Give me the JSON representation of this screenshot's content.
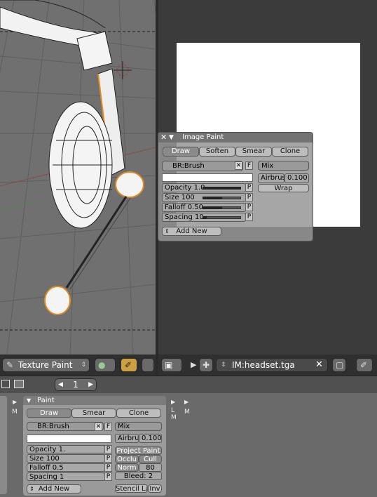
{
  "viewport3d": {
    "mode_label": "Texture Paint"
  },
  "image_editor": {
    "image_name": "IM:headset.tga"
  },
  "image_paint_panel": {
    "title": "Image Paint",
    "tabs": [
      "Draw",
      "Soften",
      "Smear",
      "Clone"
    ],
    "active_tab": "Draw",
    "brush_name": "BR:Brush",
    "brush_x": "✕",
    "brush_f": "F",
    "blend_mode": "Mix",
    "airbrush_label": "Airbrus",
    "airbrush_value": "0.100",
    "wrap_label": "Wrap",
    "opacity_label": "Opacity 1.0",
    "size_label": "Size 100",
    "falloff_label": "Falloff 0.50",
    "spacing_label": "Spacing 10.",
    "p_label": "P",
    "add_new": "Add New",
    "opacity_level": 1.0,
    "size_level": 0.5,
    "falloff_level": 0.5,
    "spacing_level": 0.1
  },
  "bottom": {
    "frame_value": "1",
    "panel_title": "Paint",
    "tabs": [
      "Draw",
      "Smear",
      "Clone"
    ],
    "brush_name": "BR:Brush",
    "blend_mode": "Mix",
    "airbrush_label": "Airbru",
    "airbrush_value": "0.100",
    "project_paint": "Project Paint",
    "occlu": "Occlu",
    "cull": "Cull",
    "norm": "Norm",
    "norm_value": "80",
    "bleed": "Bleed: 2",
    "stencil": "Stencil La",
    "inv": "Inv",
    "opacity_label": "Opacity 1.",
    "size_label": "Size 100",
    "falloff_label": "Falloff 0.5",
    "spacing_label": "Spacing 1",
    "add_new": "Add New",
    "l_m_tab": "L\nM",
    "m_tab": "M",
    "left_m": "M"
  }
}
